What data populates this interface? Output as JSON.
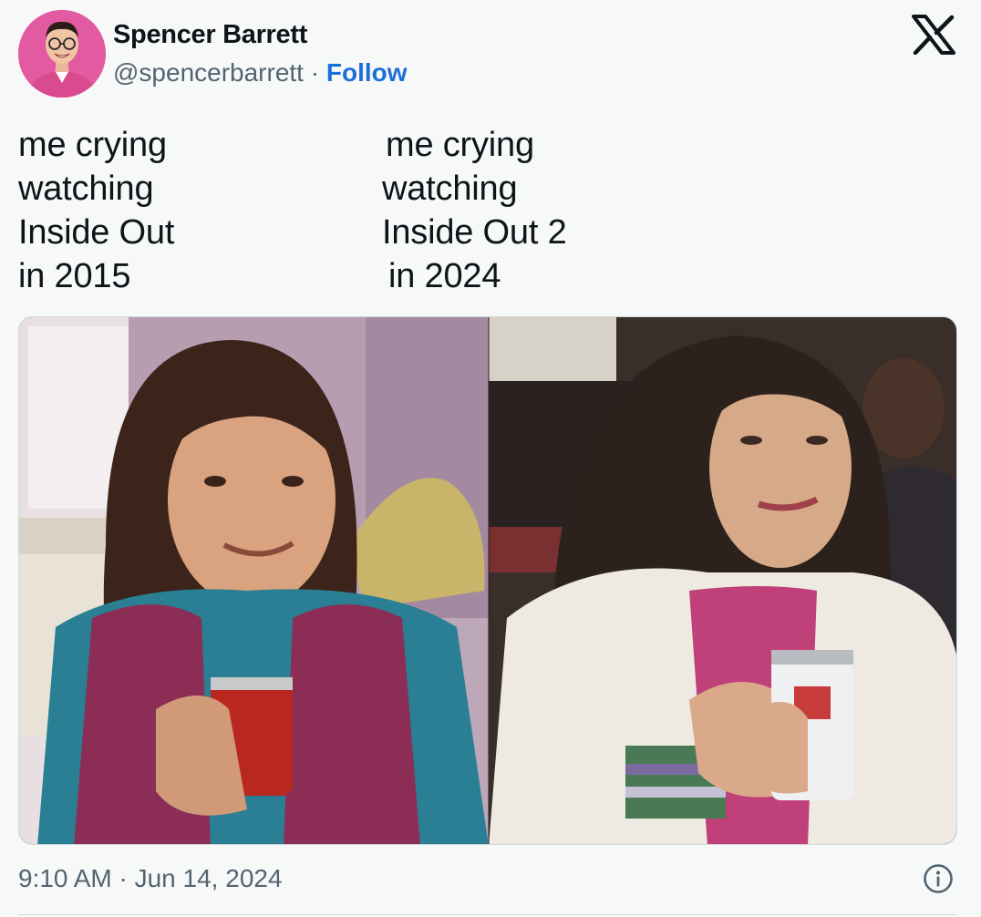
{
  "author": {
    "display_name": "Spencer Barrett",
    "handle": "@spencerbarrett",
    "separator": "·",
    "follow_label": "Follow"
  },
  "icons": {
    "brand": "x-logo-icon",
    "info": "info-icon"
  },
  "meme": {
    "left_caption": [
      "me crying",
      "watching",
      "Inside Out",
      "in 2015"
    ],
    "right_caption": [
      "me crying",
      "watching",
      "Inside Out 2",
      "in 2024"
    ]
  },
  "footer": {
    "timestamp": "9:10 AM · Jun 14, 2024"
  },
  "colors": {
    "link": "#1d6fd8",
    "secondary_text": "#536471",
    "background": "#f7f9f9"
  }
}
